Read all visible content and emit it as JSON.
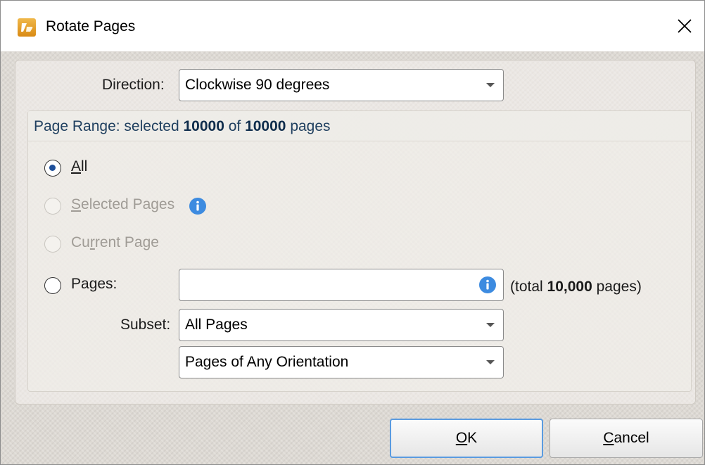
{
  "window": {
    "title": "Rotate Pages",
    "app_icon": "pdf-xchange-logo-icon",
    "close_icon": "close-icon"
  },
  "direction": {
    "label": "Direction:",
    "selected": "Clockwise 90 degrees"
  },
  "page_range": {
    "header_prefix": "Page Range: selected ",
    "selected_count": "10000",
    "of_text": " of ",
    "total_count": "10000",
    "suffix": " pages",
    "options": [
      {
        "label_first": "A",
        "label_rest": "ll",
        "checked": true,
        "enabled": true
      },
      {
        "label_first": "S",
        "label_rest": "elected Pages",
        "checked": false,
        "enabled": false
      },
      {
        "label_first": "Cu",
        "label_u": "r",
        "label_rest": "rent Page",
        "checked": false,
        "enabled": false
      },
      {
        "label_first": "Pa",
        "label_u": "g",
        "label_rest": "es:",
        "checked": false,
        "enabled": true
      }
    ],
    "pages_input_value": "",
    "total_prefix": "(total ",
    "total_pages": "10,000",
    "total_suffix": " pages)",
    "subset_label": "Subset:",
    "subset_selected": "All Pages",
    "orientation_selected": "Pages of Any Orientation"
  },
  "buttons": {
    "ok_u": "O",
    "ok_rest": "K",
    "cancel_u": "C",
    "cancel_rest": "ancel"
  },
  "colors": {
    "accent": "#3d8be0",
    "default_button_border": "#5a9be0",
    "header_text": "#1f3f5f"
  }
}
